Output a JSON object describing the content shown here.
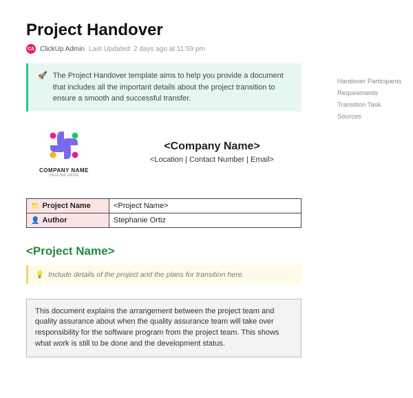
{
  "header": {
    "title": "Project Handover",
    "avatar_initials": "CA",
    "byline": "ClickUp Admin",
    "updated": "Last Updated: 2 days ago at 11:59 pm"
  },
  "banner": {
    "icon": "🚀",
    "text": "The Project Handover template aims to help you provide a document that includes all the important details about the project transition to ensure a smooth and successful transfer."
  },
  "toc": [
    "Handover Participants",
    "Requirements",
    "Transition Task",
    "Sources"
  ],
  "company": {
    "logo_label": "COMPANY NAME",
    "logo_tagline": "TAGLINE HERE",
    "name": "<Company Name>",
    "sub": "<Location | Contact Number | Email>"
  },
  "info_table": [
    {
      "icon": "📁",
      "label": "Project Name",
      "value": "<Project Name>"
    },
    {
      "icon": "👤",
      "label": "Author",
      "value": "Stephanie Ortiz"
    }
  ],
  "project_section": {
    "heading": "<Project Name>",
    "hint_icon": "💡",
    "hint": "Include details of the project and the plans for transition here.",
    "description": "This document explains the arrangement between the project team and quality assurance about when the quality assurance team will take over responsibility for the software program from the project team. This shows what work is still to be done and the development status."
  }
}
